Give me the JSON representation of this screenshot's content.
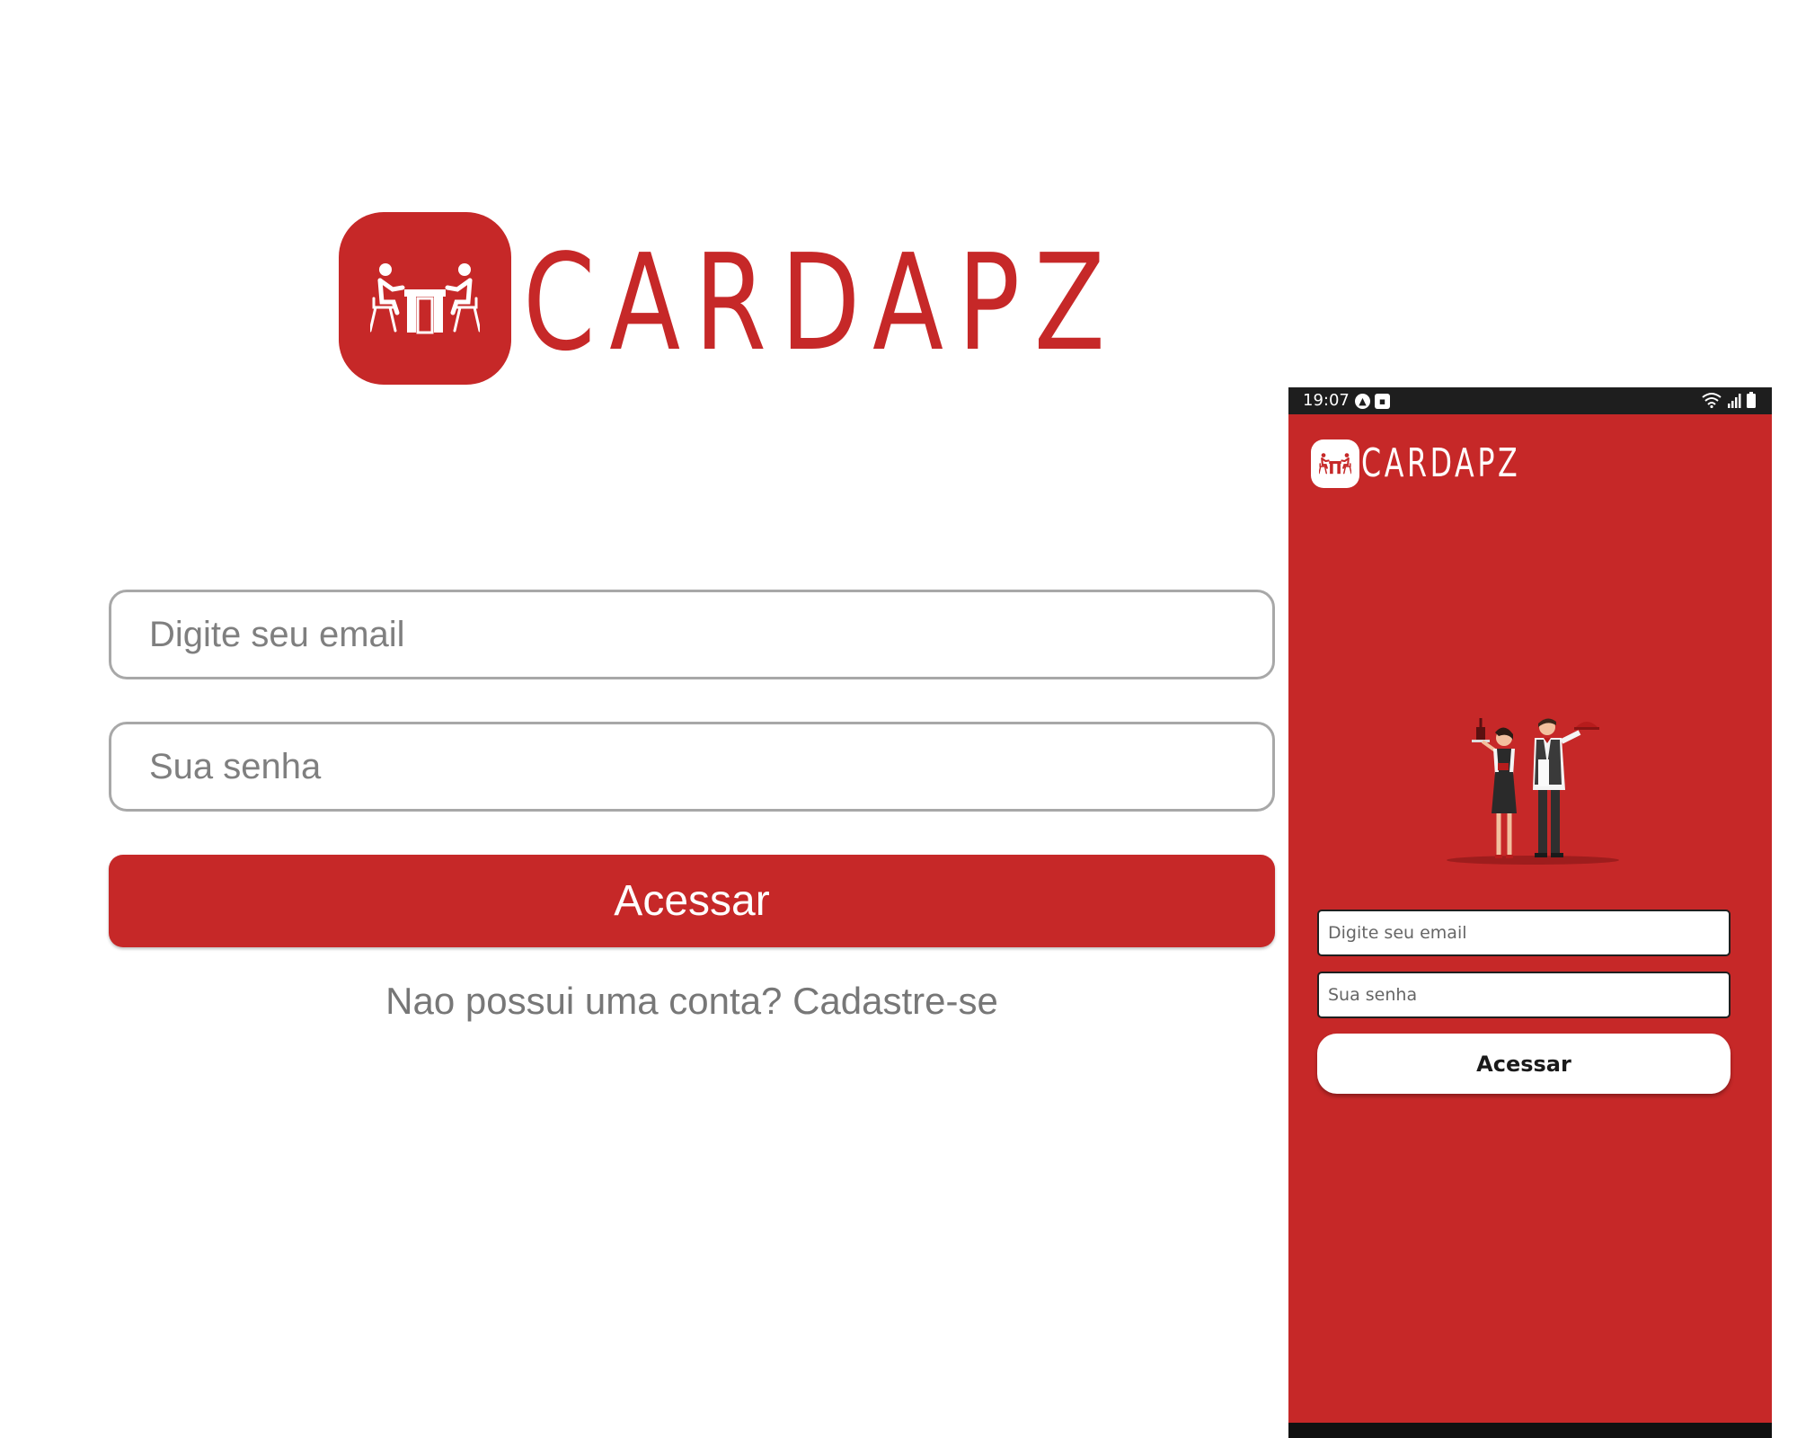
{
  "web": {
    "brand": "CARDAPZ",
    "email_placeholder": "Digite seu email",
    "password_placeholder": "Sua senha",
    "login_label": "Acessar",
    "signup_text": "Nao possui uma conta? Cadastre-se"
  },
  "mobile": {
    "status_time": "19:07",
    "brand": "CARDAPZ",
    "email_placeholder": "Digite seu email",
    "password_placeholder": "Sua senha",
    "login_label": "Acessar"
  },
  "colors": {
    "brand_red": "#c62828",
    "white": "#ffffff",
    "status_bar": "#1e1e1e"
  }
}
